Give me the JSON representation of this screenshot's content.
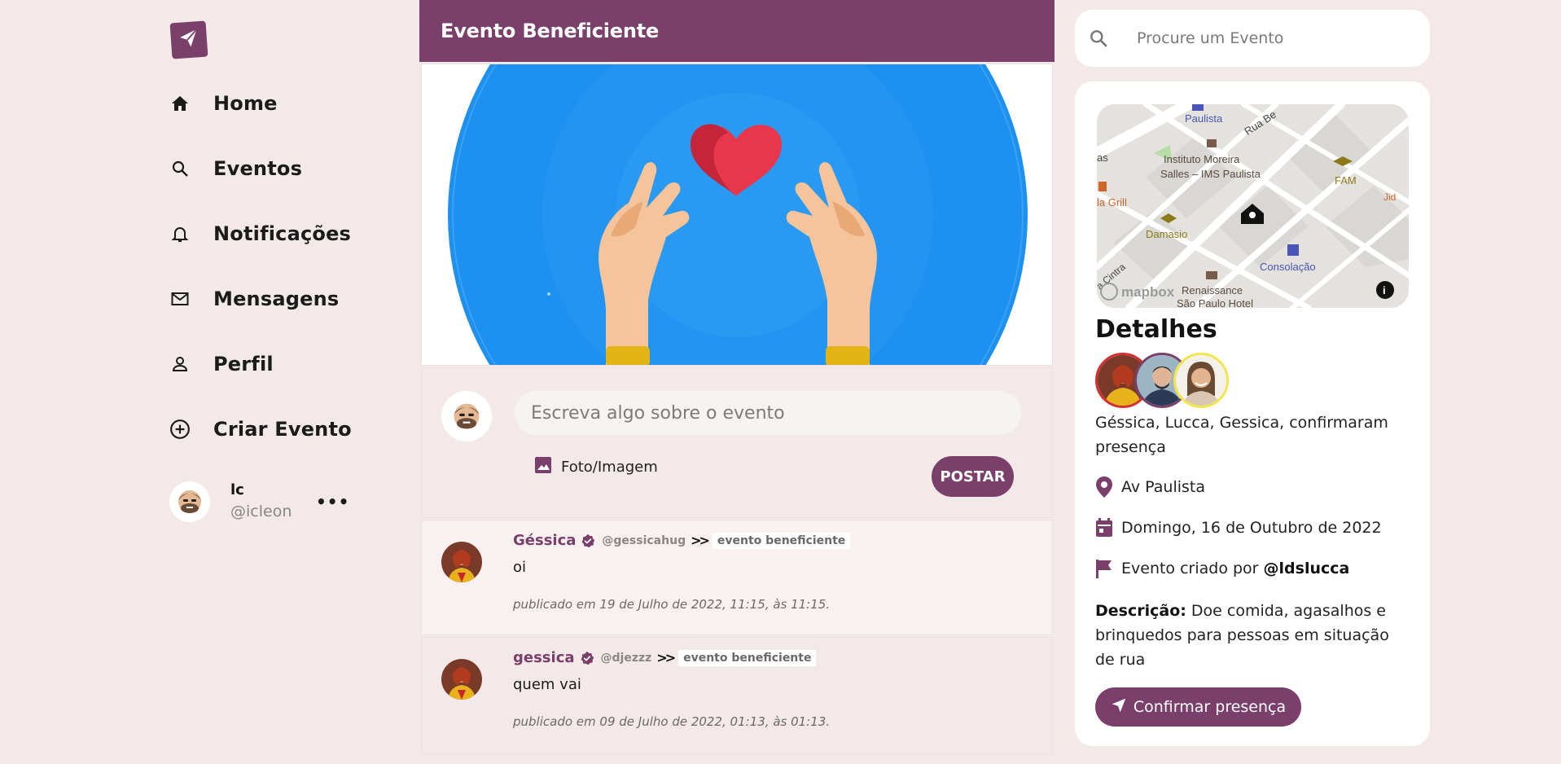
{
  "colors": {
    "accent": "#7b3f6b",
    "background": "#f3e9e9",
    "card": "#ffffff"
  },
  "sidebar": {
    "logo_icon": "paper-plane-icon",
    "items": [
      {
        "label": "Home",
        "icon": "home-icon"
      },
      {
        "label": "Eventos",
        "icon": "search-icon"
      },
      {
        "label": "Notificações",
        "icon": "bell-icon"
      },
      {
        "label": "Mensagens",
        "icon": "mail-icon"
      },
      {
        "label": "Perfil",
        "icon": "person-icon"
      },
      {
        "label": "Criar Evento",
        "icon": "add-circle-icon"
      }
    ],
    "user": {
      "name": "lc",
      "handle": "@icleon",
      "more": "•••"
    }
  },
  "event": {
    "title": "Evento Beneficiente"
  },
  "composer": {
    "placeholder": "Escreva algo sobre o evento",
    "photo_label": "Foto/Imagem",
    "post_label": "POSTAR"
  },
  "posts": [
    {
      "author": "Géssica",
      "handle": "@gessicahug",
      "event_tag": "evento beneficiente",
      "body": "oi",
      "date": "publicado em 19 de Julho de 2022, 11:15, às 11:15."
    },
    {
      "author": "gessica",
      "handle": "@djezzz",
      "event_tag": "evento beneficiente",
      "body": "quem vai",
      "date": "publicado em 09 de Julho de 2022, 01:13, às 01:13."
    }
  ],
  "search": {
    "placeholder": "Procure um Evento"
  },
  "details": {
    "title": "Detalhes",
    "map_labels": {
      "paulista": "Paulista",
      "rua_b": "Rua Be",
      "instituto": "Instituto Moreira",
      "instituto2": "Salles – IMS Paulista",
      "fam": "FAM",
      "grill": "la Grill",
      "damasio": "Damasio",
      "consolacao": "Consolação",
      "cintra": "a Cintra",
      "renaissance": "Renaissance",
      "renaissance2": "São Paulo Hotel",
      "mapbox": "mapbox",
      "as": "as",
      "jid": "Jid"
    },
    "confirmed_text": "Géssica, Lucca, Gessica, confirmaram presença",
    "location": "Av Paulista",
    "date": "Domingo, 16 de Outubro de 2022",
    "creator_prefix": "Evento criado por ",
    "creator_handle": "@ldslucca",
    "description_label": "Descrição:",
    "description": " Doe comida, agasalhos e brinquedos para pessoas em situação de rua",
    "confirm_label": "Confirmar presença"
  }
}
